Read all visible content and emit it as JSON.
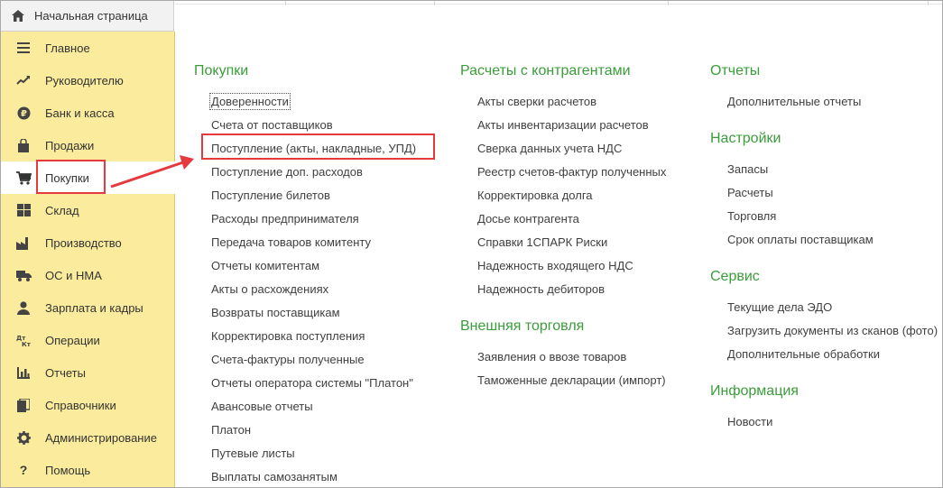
{
  "home_tab": {
    "label": "Начальная страница",
    "icon": "home-icon"
  },
  "sidebar": {
    "items": [
      {
        "label": "Главное",
        "icon": "menu-icon"
      },
      {
        "label": "Руководителю",
        "icon": "trend-up-icon"
      },
      {
        "label": "Банк и касса",
        "icon": "ruble-coin-icon"
      },
      {
        "label": "Продажи",
        "icon": "shopping-bag-icon"
      },
      {
        "label": "Покупки",
        "icon": "cart-icon"
      },
      {
        "label": "Склад",
        "icon": "warehouse-grid-icon"
      },
      {
        "label": "Производство",
        "icon": "factory-icon"
      },
      {
        "label": "ОС и НМА",
        "icon": "truck-icon"
      },
      {
        "label": "Зарплата и кадры",
        "icon": "person-icon"
      },
      {
        "label": "Операции",
        "icon": "dt-kt-icon"
      },
      {
        "label": "Отчеты",
        "icon": "bar-chart-icon"
      },
      {
        "label": "Справочники",
        "icon": "book-icon"
      },
      {
        "label": "Администрирование",
        "icon": "gear-icon"
      },
      {
        "label": "Помощь",
        "icon": "question-icon"
      }
    ],
    "active_index": 4
  },
  "columns": {
    "purchases": {
      "title": "Покупки",
      "links": [
        "Доверенности",
        "Счета от поставщиков",
        "Поступление (акты, накладные, УПД)",
        "Поступление доп. расходов",
        "Поступление билетов",
        "Расходы предпринимателя",
        "Передача товаров комитенту",
        "Отчеты комитентам",
        "Акты о расхождениях",
        "Возвраты поставщикам",
        "Корректировка поступления",
        "Счета-фактуры полученные",
        "Отчеты оператора системы \"Платон\"",
        "Авансовые отчеты",
        "Платон",
        "Путевые листы",
        "Выплаты самозанятым"
      ]
    },
    "settlements": {
      "title": "Расчеты с контрагентами",
      "links": [
        "Акты сверки расчетов",
        "Акты инвентаризации расчетов",
        "Сверка данных учета НДС",
        "Реестр счетов-фактур полученных",
        "Корректировка долга",
        "Досье контрагента",
        "Справки 1СПАРК Риски",
        "Надежность входящего НДС",
        "Надежность дебиторов"
      ]
    },
    "foreign_trade": {
      "title": "Внешняя торговля",
      "links": [
        "Заявления о ввозе товаров",
        "Таможенные декларации (импорт)"
      ]
    },
    "reports": {
      "title": "Отчеты",
      "links": [
        "Дополнительные отчеты"
      ]
    },
    "settings": {
      "title": "Настройки",
      "links": [
        "Запасы",
        "Расчеты",
        "Торговля",
        "Срок оплаты поставщикам"
      ]
    },
    "service": {
      "title": "Сервис",
      "links": [
        "Текущие дела ЭДО",
        "Загрузить документы из сканов (фото)",
        "Дополнительные обработки"
      ]
    },
    "info": {
      "title": "Информация",
      "links": [
        "Новости"
      ]
    }
  },
  "colors": {
    "sidebar_bg": "#fbec9d",
    "section_title": "#3a9d3a",
    "highlight": "#e5393e"
  }
}
